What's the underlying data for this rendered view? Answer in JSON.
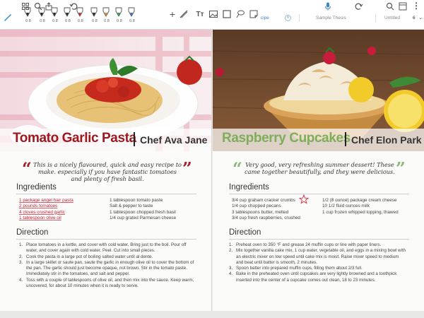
{
  "toolbar": {
    "pens": [
      {
        "size": "0.8",
        "color": "#2b2b2b"
      },
      {
        "size": "0.8",
        "color": "#2b2b2b"
      },
      {
        "size": "0.8",
        "color": "#2b2b2b"
      },
      {
        "size": "0.8",
        "color": "#2b2b2b"
      },
      {
        "size": "0.8",
        "color": "#d22b2b"
      },
      {
        "size": "0.8",
        "color": "#2b2b2b"
      },
      {
        "size": "0.8",
        "color": "#e8892e"
      },
      {
        "size": "0.8",
        "color": "#2f9e5f"
      },
      {
        "size": "0.8",
        "color": "#3b6fd1"
      }
    ],
    "text_tool_label": "Tт",
    "plus_label": "+"
  },
  "tabs": [
    {
      "label": "cipe",
      "active": true
    },
    {
      "label": "Sample Thesis",
      "active": false
    },
    {
      "label": "Untitled",
      "active": false
    }
  ],
  "page_counter": "6",
  "left_page": {
    "title": "Tomato Garlic Pasta",
    "chef": "Chef Ava Jane",
    "title_color": "#a0181e",
    "quote": "This is a nicely flavoured, quick and easy recipe to make. especially if you have fantastic tomatoes and plenty of fresh basil.",
    "quote_color": "#a6212a",
    "ingredients_heading": "Ingredients",
    "ingredients_col1": [
      "1 package angel hair pasta",
      "2 pounds tomatoes",
      "4 cloves crushed garlic",
      "1 tablespoon olive oil"
    ],
    "ingredients_col2": [
      "1 tablespoon tomato paste",
      "Salt & pepper to taste",
      "1 tablespoon chopped fresh basil",
      "1/4 cup grated Parmesan cheese"
    ],
    "direction_heading": "Direction",
    "steps": [
      "Place tomatoes in a kettle, and cover with cold water. Bring just to the boil. Pour off water, and cover again with cold water. Peel. Cut into small pieces.",
      "Cook the pasta in a large pot of boiling salted water until al dente.",
      "In a large skillet or saute pan, saute the garlic in enough olive oil to cover the bottom of the pan. The garlic should just become opaque, not brown. Stir in the tomato paste. Immediately stir in the tomatoes, and salt and pepper.",
      "Toss with a couple of tablespoons of olive oil, and then mix into the sauce. Keep warm, uncovered, for about 10 minutes when it is ready to serve."
    ]
  },
  "right_page": {
    "title": "Raspberry Cupcakes",
    "chef": "Chef Elon Park",
    "title_color": "#7fae5a",
    "quote": "Very good, very refreshing summer dessert! These came together beautifully, and they were delicious.",
    "quote_color": "#8ab87a",
    "ingredients_heading": "Ingredients",
    "ingredients_col1": [
      "3/4 cup graham cracker crumbs",
      "1/4 cup chopped pecans",
      "3 tablespoons butter, melted",
      "3/4 cup fresh raspberries, crushed"
    ],
    "ingredients_col2": [
      "1/2 (8 ounce) package cream cheese",
      "10 1/2 fluid ounces milk",
      "1 cup frozen whipped topping, thawed"
    ],
    "direction_heading": "Direction",
    "steps": [
      "Preheat oven to 350 °F and grease 24 muffin cups or line with paper liners.",
      "Mix together vanilla cake mix, 1 cup water, vegetable oil, and eggs in a mixing bowl with an electric mixer on low speed until cake mix is moist. Raise mixer speed to medium and beat until batter is smooth, 2 minutes.",
      "Spoon batter into prepared muffin cups, filling them about 2/3 full.",
      "Bake in the preheated oven until cupcakes are very lightly browned and a toothpick inserted into the center of a cupcake comes out clean, 18 to 23 minutes."
    ]
  }
}
